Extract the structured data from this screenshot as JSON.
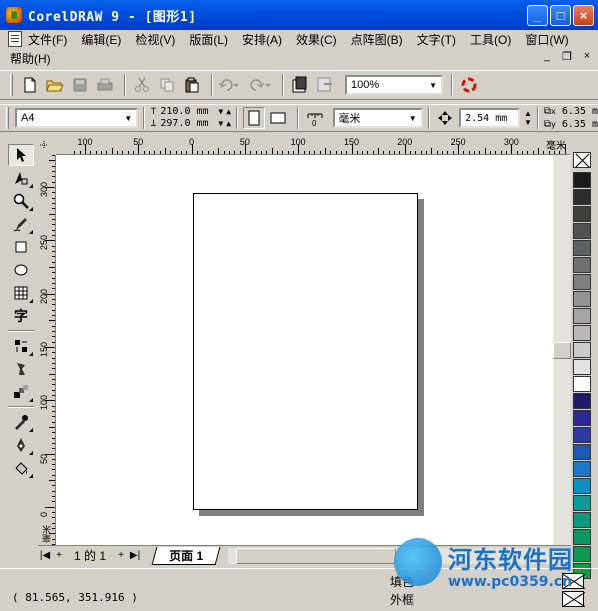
{
  "window": {
    "title": "CorelDRAW 9 - [图形1]",
    "minimize": "_",
    "maximize": "□",
    "close": "×"
  },
  "menu": [
    "文件(F)",
    "编辑(E)",
    "检视(V)",
    "版面(L)",
    "安排(A)",
    "效果(C)",
    "点阵图(B)",
    "文字(T)",
    "工具(O)",
    "窗口(W)"
  ],
  "menu2": [
    "帮助(H)"
  ],
  "mdi": {
    "minimize": "_",
    "restore": "❐",
    "close": "×"
  },
  "standard_toolbar": {
    "zoom": "100%"
  },
  "property_bar": {
    "paper": "A4",
    "width": "210.0 mm",
    "height": "297.0 mm",
    "units": "毫米",
    "nudge": "2.54 mm",
    "dup_x": "6.35 m",
    "dup_y": "6.35 m"
  },
  "ruler_h": {
    "unit": "毫米",
    "labels": [
      "100",
      "50",
      "0",
      "50",
      "100",
      "150",
      "200",
      "250",
      "300"
    ]
  },
  "ruler_v": {
    "unit": "毫米",
    "labels": [
      "300",
      "250",
      "200",
      "150",
      "100",
      "50",
      "0"
    ]
  },
  "palette": [
    "#1a1a1a",
    "#2e2e2e",
    "#404040",
    "#525252",
    "#5f6262",
    "#707070",
    "#808080",
    "#939393",
    "#a5a5a5",
    "#b8b8b8",
    "#cbcbcb",
    "#e2e2e2",
    "#ffffff",
    "#1e1a6a",
    "#2c2896",
    "#2a3aa0",
    "#1c58b4",
    "#1c78c8",
    "#0c90c4",
    "#0a9a98",
    "#0a9a7a",
    "#0a9a60",
    "#0a9a50",
    "#10a040"
  ],
  "pager": {
    "first": "|◀",
    "prev_add": "+",
    "page_of": "1 的 1",
    "next_add": "+",
    "last": "▶|",
    "tab": "页面 1"
  },
  "status": {
    "coords": "( 81.565, 351.916 )",
    "fill_label": "填色",
    "outline_label": "外框"
  },
  "watermark": {
    "title": "河东软件园",
    "url": "www.pc0359.cn"
  }
}
